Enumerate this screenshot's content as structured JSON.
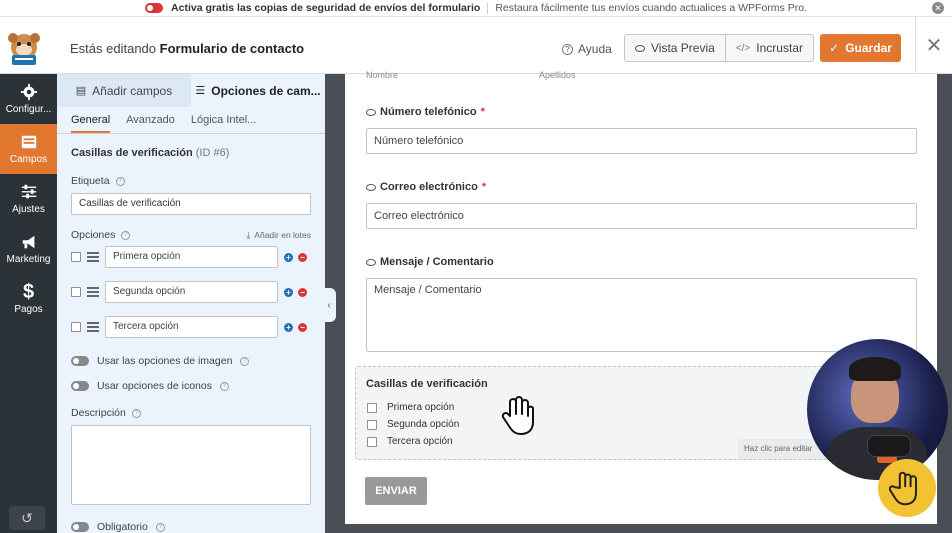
{
  "notice": {
    "strong": "Activa gratis las copias de seguridad de envíos del formulario",
    "text": "Restaura fácilmente tus envíos cuando actualices a WPForms Pro."
  },
  "header": {
    "editing_prefix": "Estás editando ",
    "form_name": "Formulario de contacto",
    "help": "Ayuda",
    "preview": "Vista Previa",
    "embed": "Incrustar",
    "save": "Guardar"
  },
  "nav": {
    "items": [
      {
        "label": "Configur...",
        "icon": "gear-icon"
      },
      {
        "label": "Campos",
        "icon": "fields-icon"
      },
      {
        "label": "Ajustes",
        "icon": "sliders-icon"
      },
      {
        "label": "Marketing",
        "icon": "megaphone-icon"
      },
      {
        "label": "Pagos",
        "icon": "dollar-icon"
      }
    ]
  },
  "panel": {
    "tabs": [
      "Añadir campos",
      "Opciones de cam..."
    ],
    "subtabs": [
      "General",
      "Avanzado",
      "Lógica Intel..."
    ],
    "field_title": "Casillas de verificación",
    "field_id": "(ID #6)",
    "label_label": "Etiqueta",
    "label_value": "Casillas de verificación",
    "options_label": "Opciones",
    "bulk_add": "Añadir en lotes",
    "options": [
      "Primera opción",
      "Segunda opción",
      "Tercera opción"
    ],
    "toggle_image": "Usar las opciones de imagen",
    "toggle_icons": "Usar opciones de iconos",
    "description_label": "Descripción",
    "required_label": "Obligatorio"
  },
  "preview": {
    "faded_first": "Nombre",
    "faded_last": "Apellidos",
    "phone_label": "Número telefónico",
    "phone_placeholder": "Número telefónico",
    "email_label": "Correo electrónico",
    "email_placeholder": "Correo electrónico",
    "message_label": "Mensaje / Comentario",
    "message_placeholder": "Mensaje / Comentario",
    "required_mark": "*",
    "checkbox_title": "Casillas de verificación",
    "checkbox_options": [
      "Primera opción",
      "Segunda opción",
      "Tercera opción"
    ],
    "edit_hint": "Haz clic para editar",
    "submit": "ENVIAR"
  },
  "colors": {
    "accent": "#e27730",
    "nav_bg": "#2c3338",
    "panel_bg": "#ebf3fc",
    "danger": "#d63638",
    "link": "#2271b1"
  }
}
